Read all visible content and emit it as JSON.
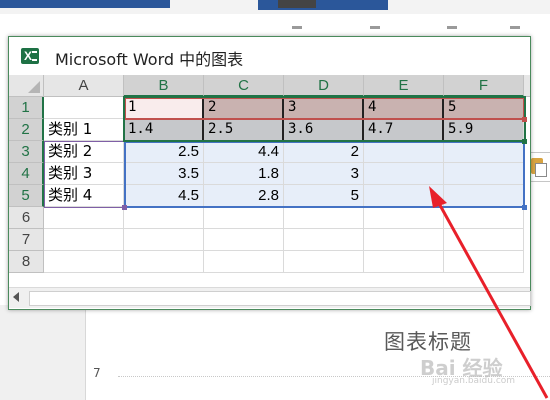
{
  "window": {
    "title": "Microsoft Word 中的图表",
    "icon": "excel-icon"
  },
  "columns": [
    "A",
    "B",
    "C",
    "D",
    "E",
    "F"
  ],
  "rows": [
    "1",
    "2",
    "3",
    "4",
    "5",
    "6",
    "7",
    "8"
  ],
  "cells": {
    "r1": [
      "",
      "1",
      "2",
      "3",
      "4",
      "5"
    ],
    "r2": [
      "类别 1",
      "1.4",
      "2.5",
      "3.6",
      "4.7",
      "5.9"
    ],
    "r3": [
      "类别 2",
      "2.5",
      "4.4",
      "2",
      "",
      ""
    ],
    "r4": [
      "类别 3",
      "3.5",
      "1.8",
      "3",
      "",
      ""
    ],
    "r5": [
      "类别 4",
      "4.5",
      "2.8",
      "5",
      "",
      ""
    ]
  },
  "document": {
    "chart_title": "图表标题",
    "page_number": "7"
  },
  "watermark": {
    "text": "Bai 经验",
    "sub": "jingyan.baidu.com"
  },
  "colors": {
    "excel_green": "#217346",
    "series_red": "#c0504d",
    "category_purple": "#7f5fa6",
    "values_blue": "#4472c4",
    "arrow_red": "#e8202a"
  }
}
